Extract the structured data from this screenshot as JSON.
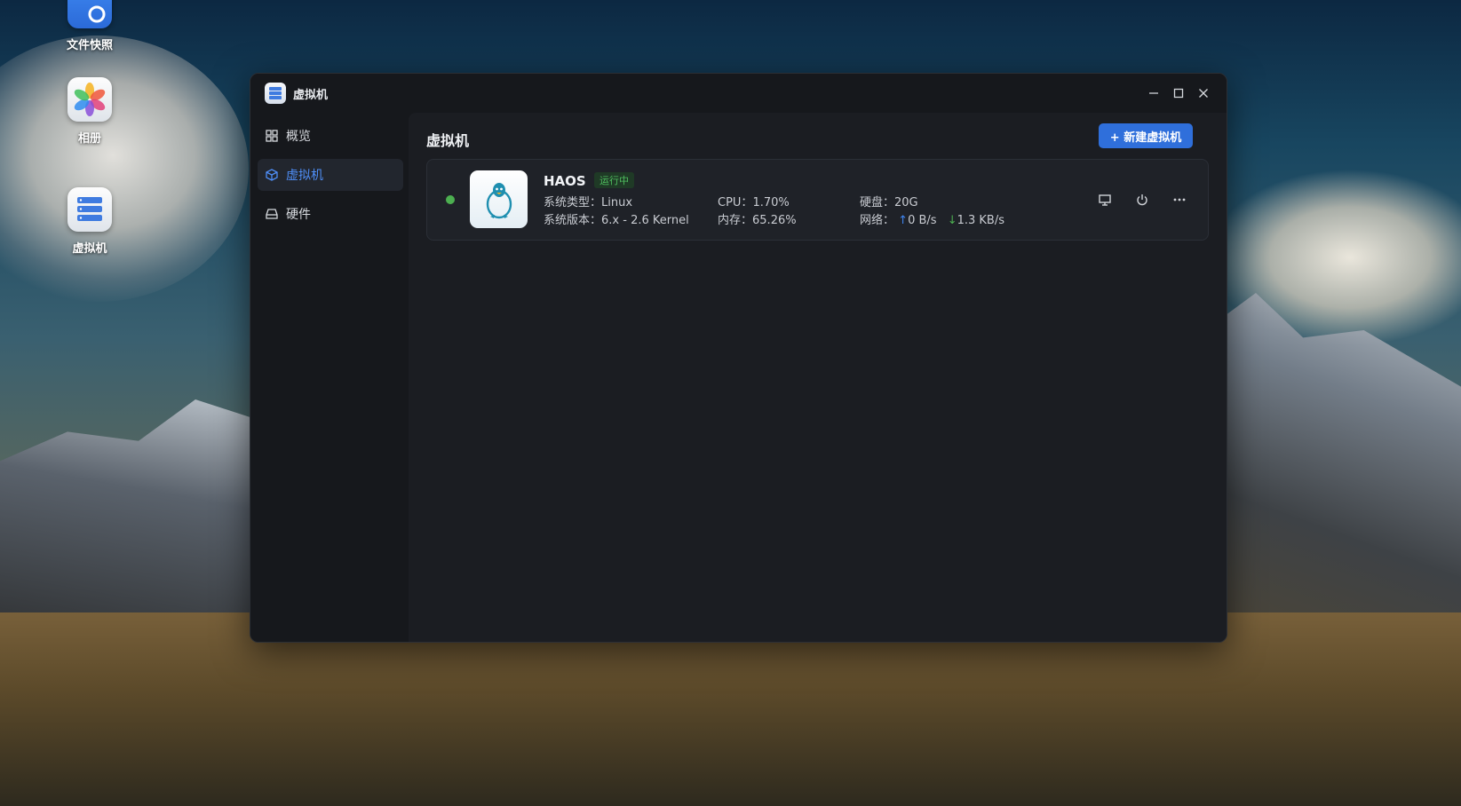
{
  "desktop": {
    "icons": [
      {
        "label": "文件快照",
        "icon": "file-snapshot-icon"
      },
      {
        "label": "相册",
        "icon": "photos-icon"
      },
      {
        "label": "虚拟机",
        "icon": "virtual-machine-icon"
      }
    ]
  },
  "window": {
    "title": "虚拟机",
    "controls": {
      "minimize": "minimize-icon",
      "maximize": "maximize-icon",
      "close": "close-icon"
    }
  },
  "sidebar": {
    "items": [
      {
        "label": "概览",
        "icon": "grid-icon",
        "active": false
      },
      {
        "label": "虚拟机",
        "icon": "cube-icon",
        "active": true
      },
      {
        "label": "硬件",
        "icon": "hard-drive-icon",
        "active": false
      }
    ]
  },
  "main": {
    "title": "虚拟机",
    "new_button": "+ 新建虚拟机",
    "vm": {
      "name": "HAOS",
      "status": "运行中",
      "os_type_label": "系统类型：",
      "os_type": "Linux",
      "os_version_label": "系统版本：",
      "os_version": "6.x - 2.6 Kernel",
      "cpu_label": "CPU：",
      "cpu": "1.70%",
      "mem_label": "内存：",
      "mem": "65.26%",
      "disk_label": "硬盘：",
      "disk": "20G",
      "net_label": "网络：",
      "net_up": "0 B/s",
      "net_down": "1.3 KB/s"
    }
  },
  "colors": {
    "accent": "#2f6fdb",
    "active_link": "#4f8ef7",
    "running": "#4caf50"
  }
}
